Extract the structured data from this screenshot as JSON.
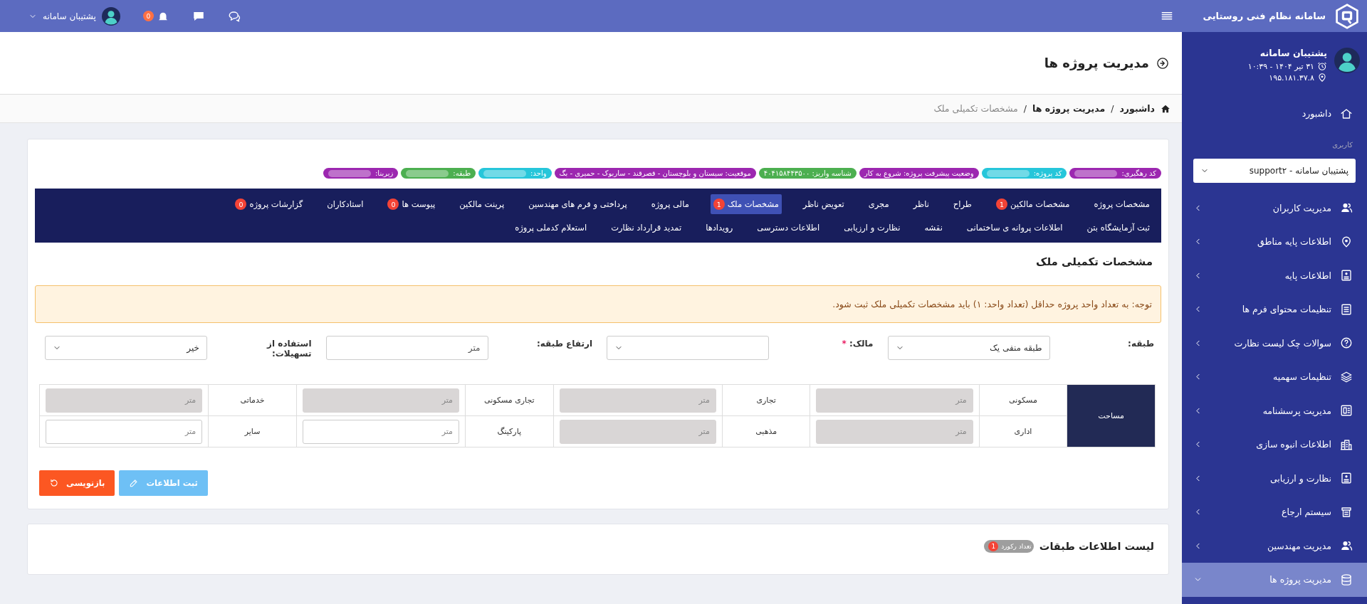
{
  "sidebar": {
    "app_title": "سامانه نظام فنی روستایی",
    "user": {
      "name": "پشتیبان سامانه",
      "datetime": "۳۱ تیر ۱۴۰۴ - ۱۰:۳۹",
      "ip": "۱۹۵.۱۸۱.۳۷.۸"
    },
    "dashboard": "داشبورد",
    "section_label": "کاربری",
    "role_select": {
      "value": "پشتیبان سامانه - support۲"
    },
    "items": [
      {
        "label": "مدیریت کاربران",
        "selected": false,
        "expanded": false
      },
      {
        "label": "اطلاعات پایه مناطق",
        "selected": false,
        "expanded": false
      },
      {
        "label": "اطلاعات پایه",
        "selected": false,
        "expanded": false
      },
      {
        "label": "تنظیمات محتوای فرم ها",
        "selected": false,
        "expanded": false
      },
      {
        "label": "سوالات چک لیست نظارت",
        "selected": false,
        "expanded": false
      },
      {
        "label": "تنظیمات سهمیه",
        "selected": false,
        "expanded": false
      },
      {
        "label": "مدیریت پرسشنامه",
        "selected": false,
        "expanded": false
      },
      {
        "label": "اطلاعات انبوه سازی",
        "selected": false,
        "expanded": false
      },
      {
        "label": "نظارت و ارزیابی",
        "selected": false,
        "expanded": false
      },
      {
        "label": "سیستم ارجاع",
        "selected": false,
        "expanded": false
      },
      {
        "label": "مدیریت مهندسین",
        "selected": false,
        "expanded": false
      },
      {
        "label": "مدیریت پروژه ها",
        "selected": true,
        "expanded": true
      }
    ]
  },
  "top_bar": {
    "user_name": "پشتیبان سامانه",
    "notification_count": "0"
  },
  "page": {
    "title": "مدیریت پروژه ها",
    "breadcrumb": [
      {
        "label": "داشبورد",
        "current": false
      },
      {
        "label": "مدیریت پروژه ها",
        "current": false
      },
      {
        "label": "مشخصات تکمیلی ملک",
        "current": true
      }
    ],
    "separator": "/"
  },
  "info_badges": [
    {
      "label": "کد رهگیری:",
      "color": "#9c27b0",
      "redacted": true
    },
    {
      "label": "کد پروژه:",
      "color": "#26c6da",
      "redacted": true
    },
    {
      "label": "وضعیت پیشرفت پروژه: شروع به کار",
      "color": "#9c27b0",
      "redacted": false
    },
    {
      "label": "شناسه واریز: ۴۰۴۱۵۸۴۴۳۵۰۰",
      "color": "#4caf50",
      "redacted": false
    },
    {
      "label": "موقعیت: سیستان و بلوچستان - قصرقند - ساربوک - حمیری - بگ",
      "color": "#9c27b0",
      "redacted": false
    },
    {
      "label": "واحد:",
      "color": "#26c6da",
      "redacted": true
    },
    {
      "label": "طبقه:",
      "color": "#4caf50",
      "redacted": true
    },
    {
      "label": "زیربنا:",
      "color": "#9c27b0",
      "redacted": true
    }
  ],
  "tabs": [
    {
      "label": "مشخصات پروژه",
      "selected": false
    },
    {
      "label": "مشخصات مالکین",
      "selected": false,
      "badge": "1"
    },
    {
      "label": "طراح",
      "selected": false
    },
    {
      "label": "ناظر",
      "selected": false
    },
    {
      "label": "مجری",
      "selected": false
    },
    {
      "label": "تعویض ناظر",
      "selected": false
    },
    {
      "label": "مشخصات ملک",
      "selected": true,
      "badge": "1"
    },
    {
      "label": "مالی پروژه",
      "selected": false
    },
    {
      "label": "پرداختی و فرم های مهندسین",
      "selected": false
    },
    {
      "label": "پرینت مالکین",
      "selected": false
    },
    {
      "label": "پیوست ها",
      "selected": false,
      "badge": "0"
    },
    {
      "label": "استادکاران",
      "selected": false
    },
    {
      "label": "گزارشات پروژه",
      "selected": false,
      "badge": "0"
    },
    {
      "label": "ثبت آزمایشگاه بتن",
      "selected": false
    },
    {
      "label": "اطلاعات پروانه ی ساختمانی",
      "selected": false
    },
    {
      "label": "نقشه",
      "selected": false
    },
    {
      "label": "نظارت و ارزیابی",
      "selected": false
    },
    {
      "label": "اطلاعات دسترسی",
      "selected": false
    },
    {
      "label": "رویدادها",
      "selected": false
    },
    {
      "label": "تمدید قرارداد نظارت",
      "selected": false
    },
    {
      "label": "استعلام کدملی پروژه",
      "selected": false
    }
  ],
  "section_title": "مشخصات تکمیلی ملک",
  "alert": "توجه: به تعداد واحد پروژه حداقل (تعداد واحد: ۱) باید مشخصات تکمیلی ملک ثبت شود.",
  "form_fields": [
    {
      "label": "طبقه:",
      "kind": "select",
      "value": "طبقه منفی یک"
    },
    {
      "label": "مالک:",
      "kind": "select",
      "required_mark": "*"
    },
    {
      "label": "ارتفاع طبقه:",
      "kind": "input",
      "placeholder": "متر"
    },
    {
      "label": "استفاده از تسهیلات:",
      "kind": "select",
      "value": "خیر"
    }
  ],
  "area_table": {
    "header": "مساحت",
    "rows": [
      [
        {
          "label": "مسکونی",
          "placeholder": "متر",
          "disabled": true
        },
        {
          "label": "تجاری",
          "placeholder": "متر",
          "disabled": true
        },
        {
          "label": "تجاری مسکونی",
          "placeholder": "متر",
          "disabled": true
        },
        {
          "label": "خدماتی",
          "placeholder": "متر",
          "disabled": true
        }
      ],
      [
        {
          "label": "اداری",
          "placeholder": "متر",
          "disabled": true
        },
        {
          "label": "مذهبی",
          "placeholder": "متر",
          "disabled": true
        },
        {
          "label": "پارکینگ",
          "placeholder": "متر",
          "disabled": false
        },
        {
          "label": "سایر",
          "placeholder": "متر",
          "disabled": false
        }
      ]
    ]
  },
  "buttons": [
    {
      "label": "ثبت اطلاعات",
      "kind": "submit"
    },
    {
      "label": "بازنویسی",
      "kind": "reset"
    }
  ],
  "floors_list": {
    "title": "لیست اطلاعات طبقات",
    "count_label": "تعداد رکورد",
    "count": "1"
  }
}
